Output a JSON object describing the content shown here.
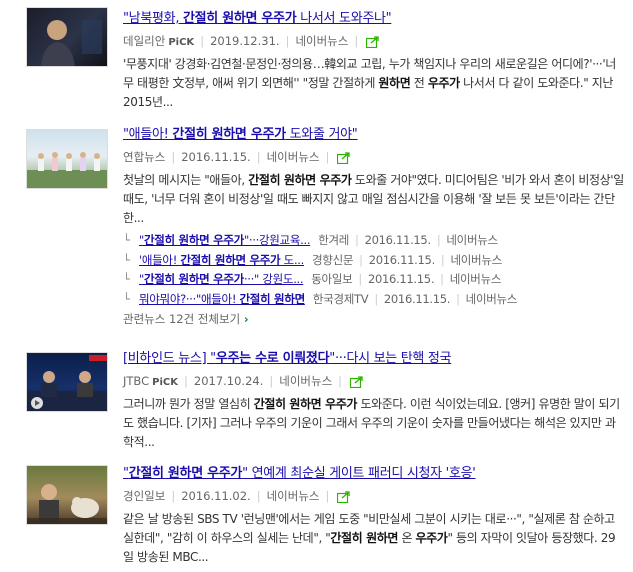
{
  "items": [
    {
      "title_parts": [
        "\"남북평화, ",
        "간절히 원하면 우주가",
        " 나서서 도와주나\""
      ],
      "source": "데일리안",
      "pick": "PiCK",
      "date": "2019.12.31.",
      "portal": "네이버뉴스",
      "desc_html": "'무풍지대' 강경화·김연철·문정인·정의용…韓외교 고립, 누가 책임지나 우리의 새로운길은 어디에?'···'너무 태평한 文정부, 애써 위기 외면해'' \"정말 간절하게 <b>원하면</b> 전 <b>우주가</b> 나서서 다 같이 도와준다.\" 지난 2015년..."
    },
    {
      "title_parts": [
        "\"애들아! ",
        "간절히 원하면 우주가",
        " 도와줄 거야\""
      ],
      "source": "연합뉴스",
      "date": "2016.11.15.",
      "portal": "네이버뉴스",
      "desc_html": "첫날의 메시지는 \"애들아, <b>간절히 원하면 우주가</b> 도와줄 거야\"였다. 미디어팀은 '비가 와서 혼이 비정상'일 때도, '너무 더워 혼이 비정상'일 때도 빠지지 않고 매일 점심시간을 이용해 '잘 보든 못 보든'이라는 간단한...",
      "related": [
        {
          "t1": "\"",
          "b": "간절히 원하면 우주가",
          "t2": "\"···강원교육...",
          "src": "한겨레",
          "date": "2016.11.15.",
          "portal": "네이버뉴스"
        },
        {
          "t1": "'애들아! ",
          "b": "간절히 원하면 우주가",
          "t2": " 도...",
          "src": "경향신문",
          "date": "2016.11.15.",
          "portal": "네이버뉴스"
        },
        {
          "t1": "\"",
          "b": "간절히 원하면 우주가",
          "t2": "···\" 강원도...",
          "src": "동아일보",
          "date": "2016.11.15.",
          "portal": "네이버뉴스"
        },
        {
          "t1": "뭐야뭐야?···\"애들아! ",
          "b": "간절히 원하면",
          "t2": "",
          "src": "한국경제TV",
          "date": "2016.11.15.",
          "portal": "네이버뉴스"
        }
      ],
      "more_label": "관련뉴스 12건 전체보기",
      "more_chev": "›"
    },
    {
      "title_parts": [
        "[비하인드 뉴스] \"",
        "우주는 수로 이뤄졌다",
        "\"···다시 보는 탄핵 정국"
      ],
      "source": "JTBC",
      "pick": "PiCK",
      "date": "2017.10.24.",
      "portal": "네이버뉴스",
      "desc_html": "그러니까 뭔가 정말 열심히 <b>간절히 원하면 우주가</b> 도와준다. 이런 식이었는데요. [앵커] 유명한 말이 되기도 했습니다. [기자] 그러나 우주의 기운이 그래서 우주의 기운이 숫자를 만들어냈다는 해석은 있지만 과학적..."
    },
    {
      "title_parts": [
        "\"",
        "간절히 원하면 우주가",
        "\" 연예계 최순실 게이트 패러디 시청자 '호응'"
      ],
      "source": "경인일보",
      "date": "2016.11.02.",
      "portal": "네이버뉴스",
      "desc_html": "같은 날 방송된 SBS TV '런닝맨'에서는 게임 도중 \"비만실세 그분이 시키는 대로···\", \"실제론 참 순하고 실한데\", \"감히 이 하우스의 실세는 난데\", \"<b>간절히 원하면</b> 온 <b>우주가</b>\" 등의 자막이 잇달아 등장했다. 29일 방송된 MBC..."
    }
  ]
}
